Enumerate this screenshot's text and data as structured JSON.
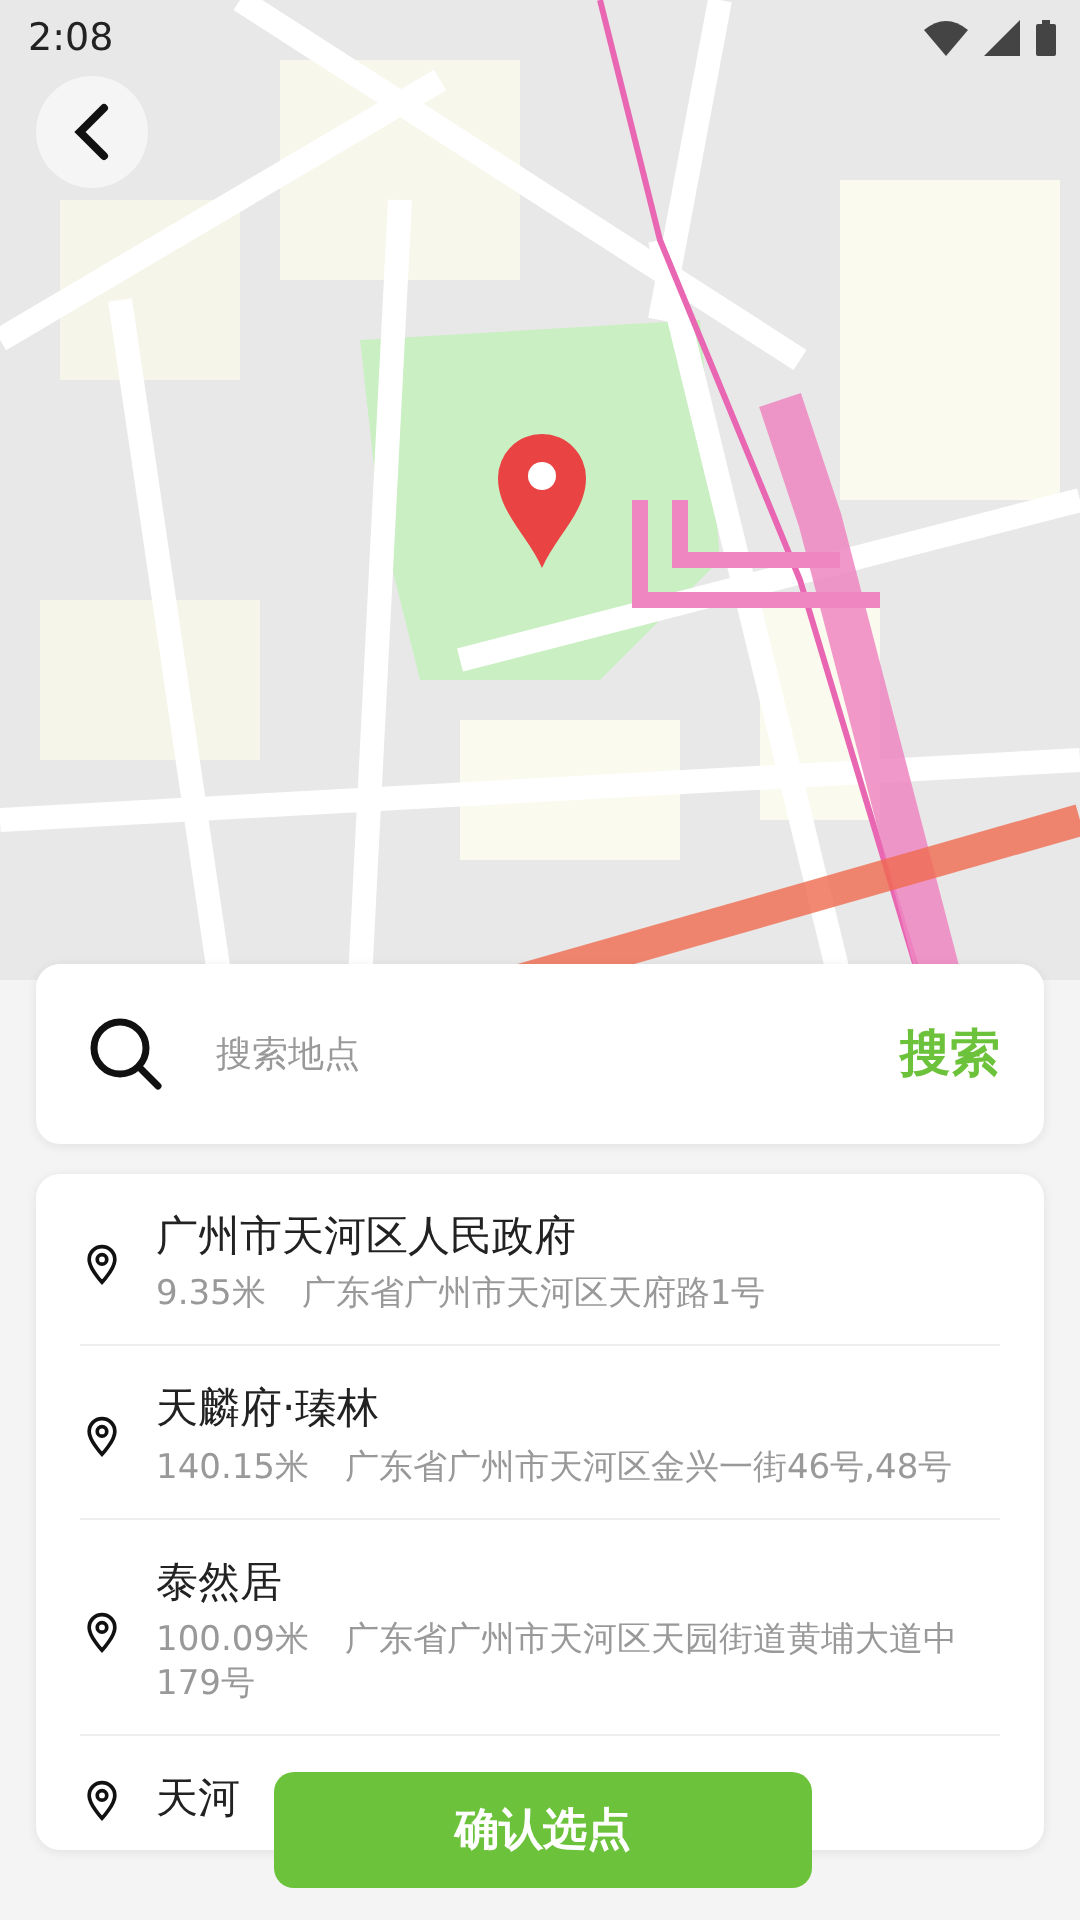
{
  "status_bar": {
    "time": "2:08"
  },
  "search": {
    "placeholder": "搜索地点",
    "button": "搜索"
  },
  "places": [
    {
      "name": "广州市天河区人民政府",
      "distance": "9.35米",
      "address": "广东省广州市天河区天府路1号"
    },
    {
      "name": "天麟府·瑧林",
      "distance": "140.15米",
      "address": "广东省广州市天河区金兴一街46号,48号"
    },
    {
      "name": "泰然居",
      "distance": "100.09米",
      "address": "广东省广州市天河区天园街道黄埔大道中179号"
    },
    {
      "name": "天河"
    }
  ],
  "confirm_button": "确认选点"
}
